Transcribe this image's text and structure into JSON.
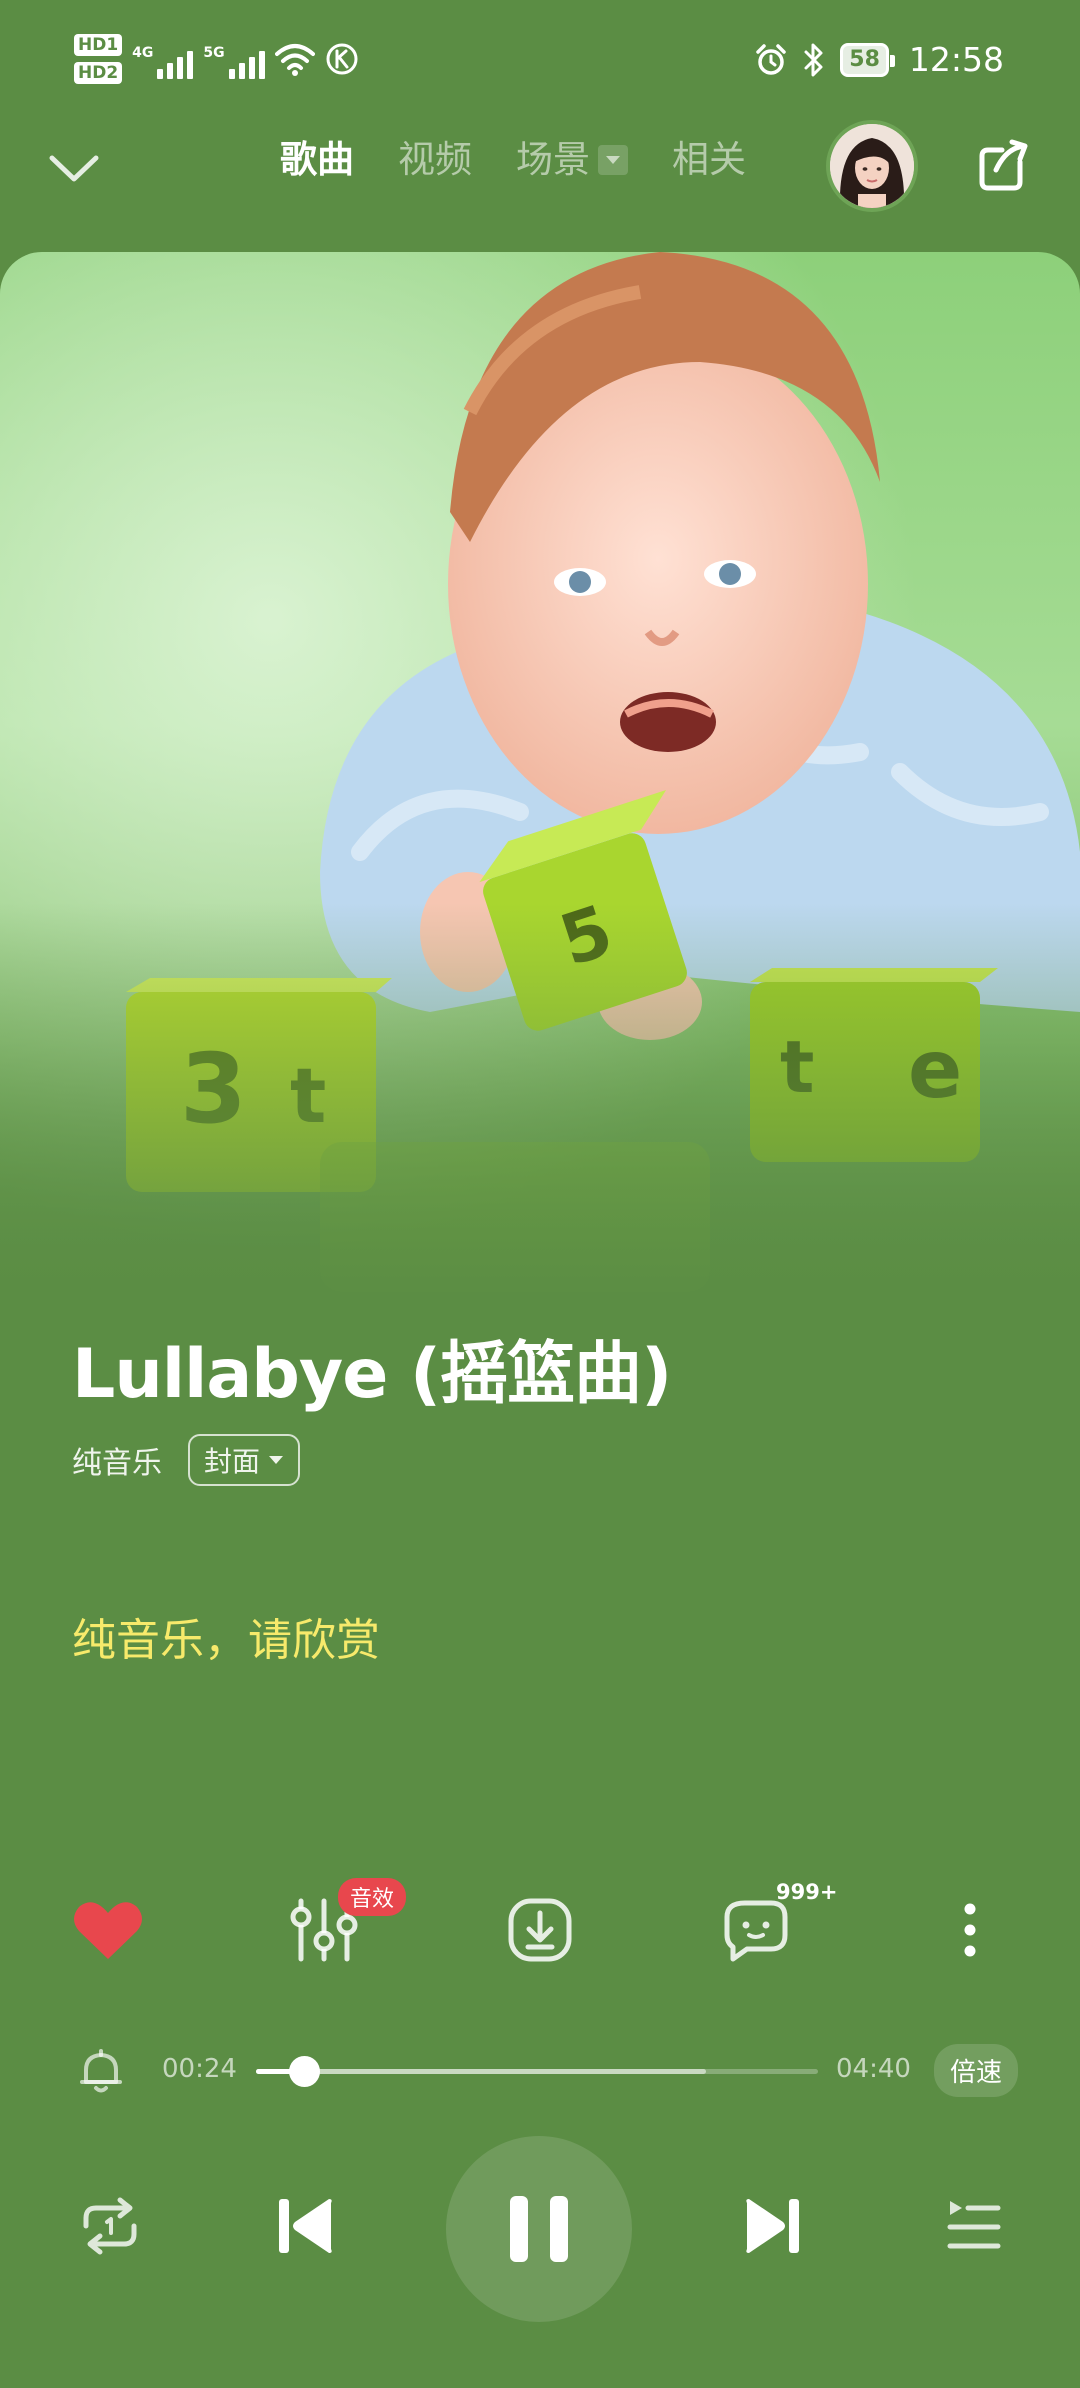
{
  "status_bar": {
    "sim1": "HD1",
    "sim2": "HD2",
    "net1": "4G",
    "net2": "5G",
    "battery": "58",
    "time": "12:58",
    "icons": [
      "wifi-icon",
      "k-icon",
      "alarm-icon",
      "bluetooth-icon",
      "battery-icon"
    ]
  },
  "nav": {
    "tabs": [
      {
        "label": "歌曲",
        "active": true
      },
      {
        "label": "视频",
        "active": false
      },
      {
        "label": "场景",
        "active": false
      },
      {
        "label": "相关",
        "active": false
      }
    ]
  },
  "song": {
    "title": "Lullabye (摇篮曲)",
    "artist": "纯音乐",
    "cover_chip": "封面",
    "lyric": "纯音乐，请欣赏"
  },
  "actions": {
    "fx_badge": "音效",
    "comment_count": "999+",
    "liked": true
  },
  "player": {
    "elapsed": "00:24",
    "duration": "04:40",
    "progress": 0.086,
    "buffered": 0.8,
    "speed_label": "倍速",
    "state": "playing"
  },
  "colors": {
    "background": "#5b8d44",
    "lyric": "#f7ea6b",
    "like": "#e8474d",
    "badge": "#e8474d"
  }
}
